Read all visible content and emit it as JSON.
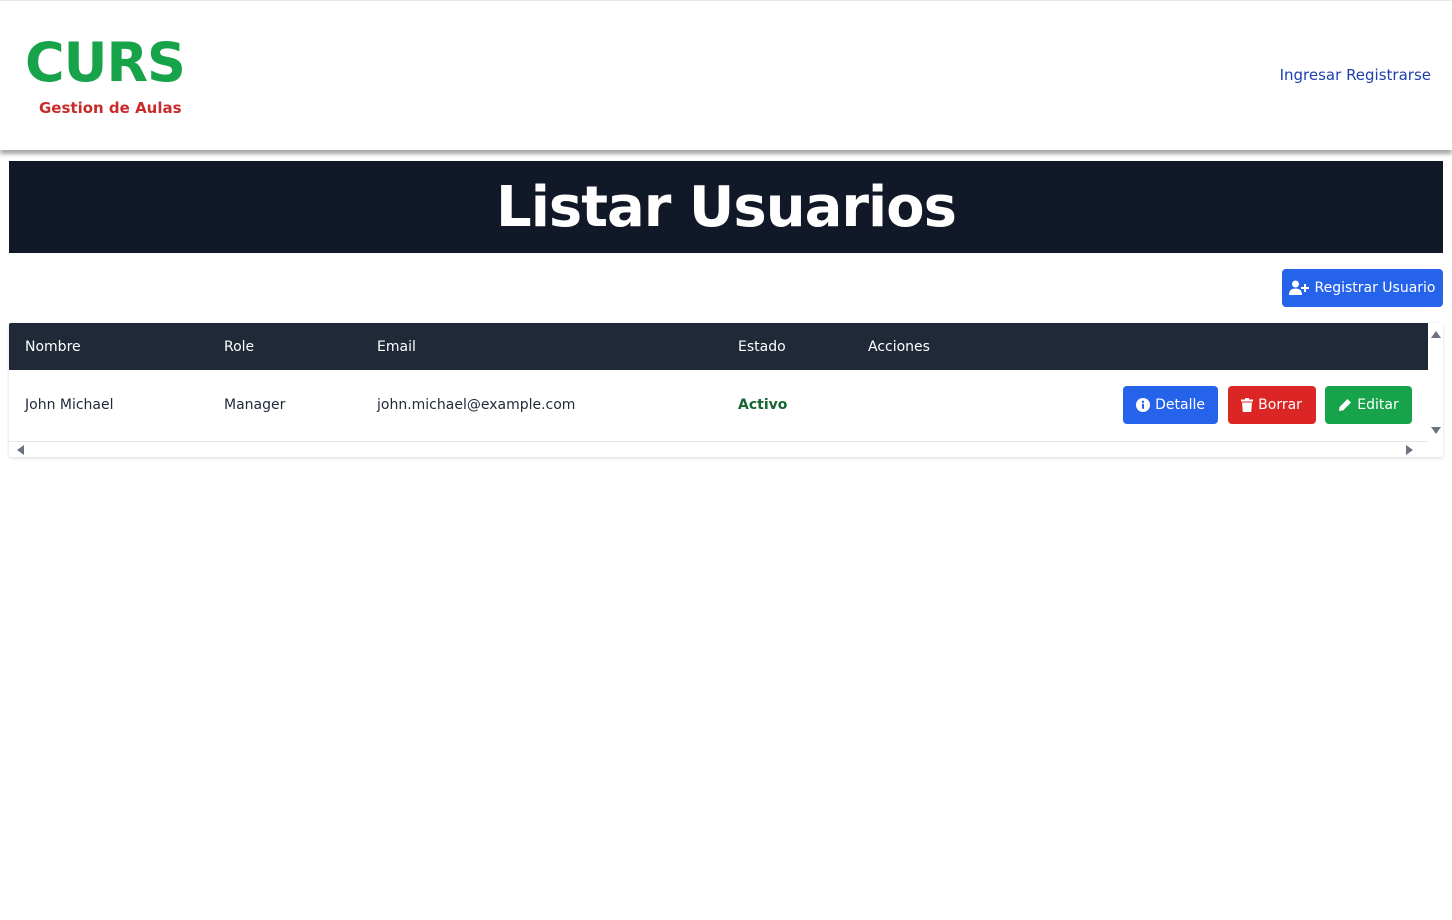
{
  "header": {
    "logo_title": "CURS",
    "logo_subtitle": "Gestion de Aulas",
    "nav": {
      "login_label": "Ingresar",
      "register_label": "Registrarse"
    }
  },
  "page": {
    "title": "Listar Usuarios"
  },
  "toolbar": {
    "register_user_label": "Registrar Usuario",
    "register_user_icon": "user-plus-icon"
  },
  "table": {
    "columns": [
      "Nombre",
      "Role",
      "Email",
      "Estado",
      "Acciones"
    ],
    "rows": [
      {
        "nombre": "John Michael",
        "role": "Manager",
        "email": "john.michael@example.com",
        "estado": "Activo",
        "actions": {
          "detail_label": "Detalle",
          "delete_label": "Borrar",
          "edit_label": "Editar"
        }
      }
    ]
  },
  "colors": {
    "brand_green": "#16a34a",
    "brand_red": "#c92a2a",
    "nav_blue": "#1e40af",
    "banner_bg": "#111827",
    "table_header_bg": "#1f2937",
    "button_blue": "#2563eb",
    "button_red": "#dc2626",
    "button_green": "#16a34a",
    "status_active": "#166534"
  }
}
